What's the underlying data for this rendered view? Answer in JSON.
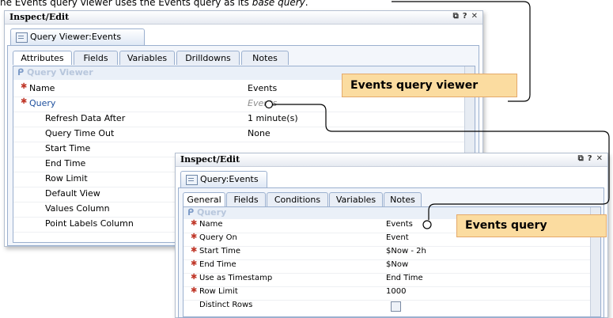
{
  "caption": {
    "prefix": "he Events query viewer uses the Events query as its ",
    "emph": "base query",
    "suffix": "."
  },
  "viewer_panel": {
    "title": "Inspect/Edit",
    "object_tab": "Query Viewer:Events",
    "tabs": [
      "Attributes",
      "Fields",
      "Variables",
      "Drilldowns",
      "Notes"
    ],
    "active_tab": "Attributes",
    "section": "Query Viewer",
    "rows": [
      {
        "label": "Name",
        "value": "Events"
      },
      {
        "label": "Query",
        "value": "Events"
      },
      {
        "label": "Refresh Data After",
        "value": "1 minute(s)"
      },
      {
        "label": "Query Time Out",
        "value": "None"
      },
      {
        "label": "Start Time",
        "value": ""
      },
      {
        "label": "End Time",
        "value": ""
      },
      {
        "label": "Row Limit",
        "value": ""
      },
      {
        "label": "Default View",
        "value": ""
      },
      {
        "label": "Values Column",
        "value": ""
      },
      {
        "label": "Point Labels Column",
        "value": ""
      }
    ]
  },
  "query_panel": {
    "title": "Inspect/Edit",
    "object_tab": "Query:Events",
    "tabs": [
      "General",
      "Fields",
      "Conditions",
      "Variables",
      "Notes"
    ],
    "active_tab": "General",
    "section": "Query",
    "rows": [
      {
        "label": "Name",
        "value": "Events"
      },
      {
        "label": "Query On",
        "value": "Event"
      },
      {
        "label": "Start Time",
        "value": "$Now - 2h"
      },
      {
        "label": "End Time",
        "value": "$Now"
      },
      {
        "label": "Use as Timestamp",
        "value": "End Time"
      },
      {
        "label": "Row Limit",
        "value": "1000"
      },
      {
        "label": "Distinct Rows",
        "value": ""
      }
    ]
  },
  "titlebar_icons": {
    "restore": "⧉",
    "help": "?",
    "close": "✕"
  },
  "callouts": {
    "viewer": "Events query viewer",
    "query": "Events query"
  },
  "colors": {
    "callout_fill": "#fbdca0",
    "callout_border": "#e4a96b",
    "required_star": "#c0392b",
    "link_blue": "#1d4f9d"
  }
}
